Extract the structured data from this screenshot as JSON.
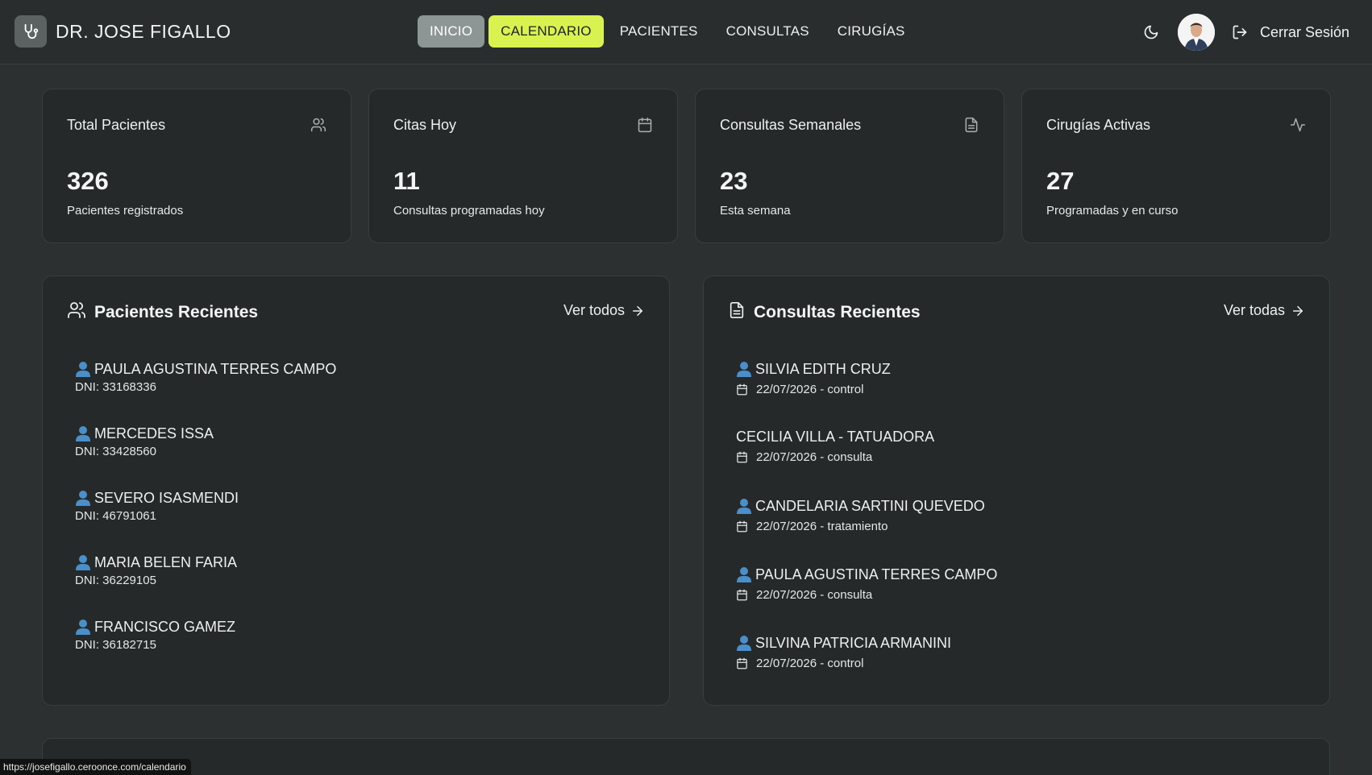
{
  "header": {
    "brand": "DR. JOSE FIGALLO",
    "brand_icon": "stethoscope-icon",
    "nav": [
      {
        "label": "INICIO"
      },
      {
        "label": "CALENDARIO"
      },
      {
        "label": "PACIENTES"
      },
      {
        "label": "CONSULTAS"
      },
      {
        "label": "CIRUGÍAS"
      }
    ],
    "logout_label": "Cerrar Sesión",
    "colors": {
      "accent": "#d9f24f",
      "active_nav": "#8e9595",
      "background": "#2c3030",
      "card": "#252929"
    }
  },
  "stats": [
    {
      "title": "Total Pacientes",
      "value": "326",
      "subtitle": "Pacientes registrados",
      "icon": "users-icon"
    },
    {
      "title": "Citas Hoy",
      "value": "11",
      "subtitle": "Consultas programadas hoy",
      "icon": "calendar-icon"
    },
    {
      "title": "Consultas Semanales",
      "value": "23",
      "subtitle": "Esta semana",
      "icon": "document-icon"
    },
    {
      "title": "Cirugías Activas",
      "value": "27",
      "subtitle": "Programadas y en curso",
      "icon": "activity-icon"
    }
  ],
  "recent_patients": {
    "title": "Pacientes Recientes",
    "link": "Ver todos",
    "items": [
      {
        "name": "PAULA AGUSTINA TERRES CAMPO",
        "dni": "DNI: 33168336"
      },
      {
        "name": "MERCEDES ISSA",
        "dni": "DNI: 33428560"
      },
      {
        "name": "SEVERO ISASMENDI",
        "dni": "DNI: 46791061"
      },
      {
        "name": "MARIA BELEN FARIA",
        "dni": "DNI: 36229105"
      },
      {
        "name": "FRANCISCO GAMEZ",
        "dni": "DNI: 36182715"
      }
    ]
  },
  "recent_consults": {
    "title": "Consultas Recientes",
    "link": "Ver todas",
    "items": [
      {
        "name": "SILVIA EDITH CRUZ",
        "date": "22/07/2026 - control"
      },
      {
        "name": "CECILIA VILLA - TATUADORA",
        "date": "22/07/2026 - consulta"
      },
      {
        "name": "CANDELARIA SARTINI QUEVEDO",
        "date": "22/07/2026 - tratamiento"
      },
      {
        "name": "PAULA AGUSTINA TERRES CAMPO",
        "date": "22/07/2026 - consulta"
      },
      {
        "name": "SILVINA PATRICIA ARMANINI",
        "date": "22/07/2026 - control"
      }
    ]
  },
  "status_bar": {
    "url": "https://josefigallo.ceroonce.com/calendario"
  }
}
